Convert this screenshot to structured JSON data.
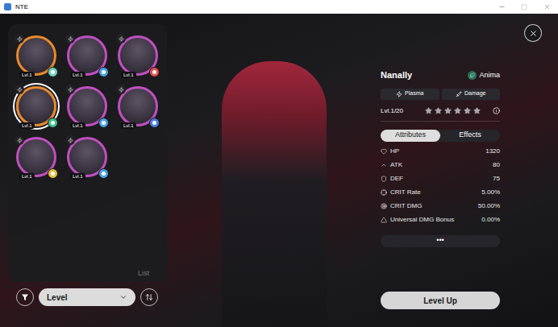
{
  "window": {
    "title": "NTE"
  },
  "roster": {
    "characters": [
      {
        "level": "Lvl.1",
        "selected": false,
        "color": "#e8892a",
        "element_color": "#6fcfc2"
      },
      {
        "level": "Lvl.1",
        "selected": false,
        "color": "#c04fc0",
        "element_color": "#4aa3e0"
      },
      {
        "level": "Lvl.1",
        "selected": false,
        "color": "#c04fc0",
        "element_color": "#e05050"
      },
      {
        "level": "Lvl.1",
        "selected": true,
        "color": "#e8892a",
        "element_color": "#3fbf8f"
      },
      {
        "level": "Lvl.1",
        "selected": false,
        "color": "#c04fc0",
        "element_color": "#4aa3e0"
      },
      {
        "level": "Lvl.1",
        "selected": false,
        "color": "#c04fc0",
        "element_color": "#4a7fe0"
      },
      {
        "level": "Lvl.1",
        "selected": false,
        "color": "#c04fc0",
        "element_color": "#e0c040"
      },
      {
        "level": "Lvl.1",
        "selected": false,
        "color": "#c04fc0",
        "element_color": "#4aa3e0"
      }
    ],
    "list_label": "List"
  },
  "sort": {
    "field": "Level"
  },
  "character": {
    "name": "Nanally",
    "attribute": "Anima",
    "tags": [
      "Plasma",
      "Damage"
    ],
    "level": "Lvl.1/20",
    "stars": 0,
    "tabs": [
      {
        "label": "Attributes",
        "selected": true
      },
      {
        "label": "Effects",
        "selected": false
      }
    ],
    "attributes": [
      {
        "label": "HP",
        "value": "1320"
      },
      {
        "label": "ATK",
        "value": "80"
      },
      {
        "label": "DEF",
        "value": "75"
      },
      {
        "label": "CRIT Rate",
        "value": "5.00%"
      },
      {
        "label": "CRIT DMG",
        "value": "50.00%"
      },
      {
        "label": "Universal DMG Bonus",
        "value": "0.00%"
      }
    ],
    "more": "•••",
    "level_up": "Level Up"
  }
}
